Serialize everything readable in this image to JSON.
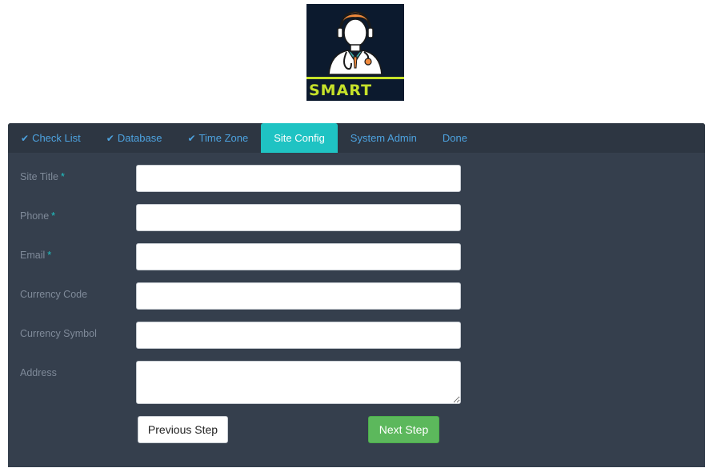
{
  "logo": {
    "text": "SMART"
  },
  "tabs": [
    {
      "label": "Check List",
      "checked": true
    },
    {
      "label": "Database",
      "checked": true
    },
    {
      "label": "Time Zone",
      "checked": true
    },
    {
      "label": "Site Config",
      "checked": false,
      "active": true
    },
    {
      "label": "System Admin",
      "checked": false
    },
    {
      "label": "Done",
      "checked": false
    }
  ],
  "form": {
    "site_title_label": "Site Title",
    "phone_label": "Phone",
    "email_label": "Email",
    "currency_code_label": "Currency Code",
    "currency_symbol_label": "Currency Symbol",
    "address_label": "Address",
    "required_mark": "*",
    "site_title_value": "",
    "phone_value": "",
    "email_value": "",
    "currency_code_value": "",
    "currency_symbol_value": "",
    "address_value": ""
  },
  "buttons": {
    "previous": "Previous Step",
    "next": "Next Step"
  },
  "colors": {
    "panel": "#353f4d",
    "tabbar": "#2d3642",
    "tab_text": "#4da3e0",
    "active_tab": "#1fc3c3",
    "next_button": "#5cb85c"
  }
}
